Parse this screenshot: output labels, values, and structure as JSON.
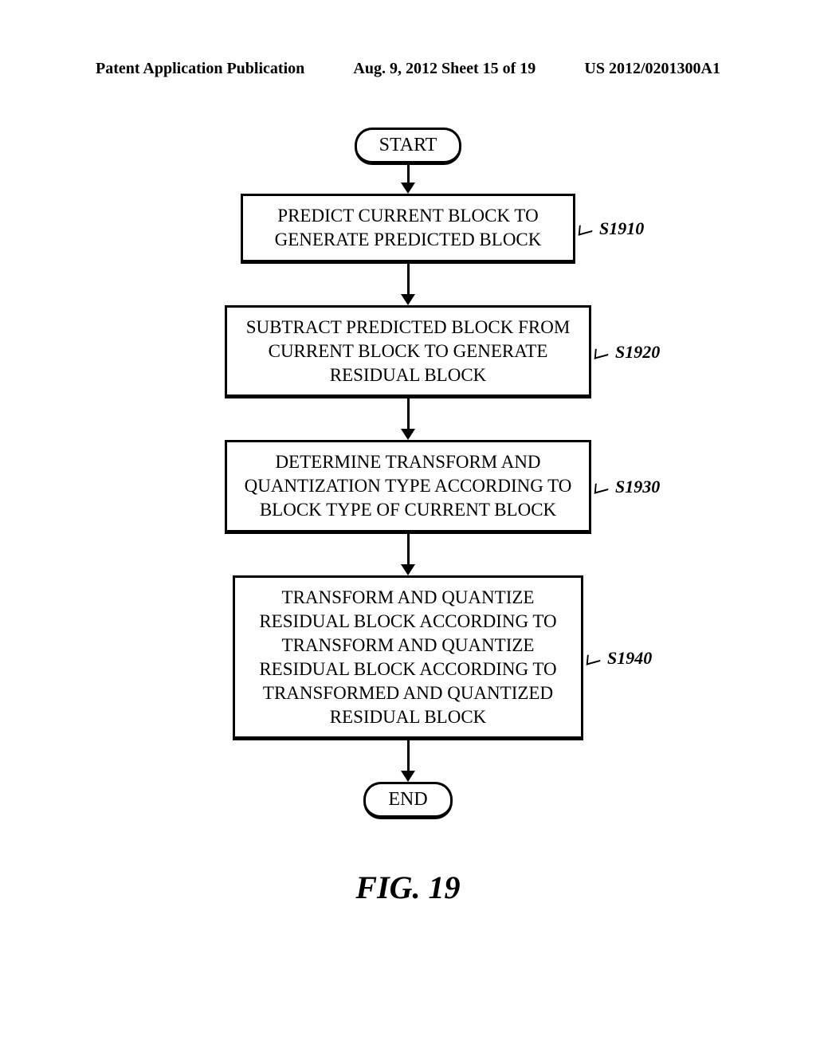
{
  "header": {
    "left": "Patent Application Publication",
    "center": "Aug. 9, 2012  Sheet 15 of 19",
    "right": "US 2012/0201300A1"
  },
  "flowchart": {
    "start": "START",
    "end": "END",
    "steps": [
      {
        "text": "PREDICT CURRENT BLOCK TO\nGENERATE PREDICTED BLOCK",
        "label": "S1910"
      },
      {
        "text": "SUBTRACT PREDICTED BLOCK FROM\nCURRENT BLOCK TO GENERATE\nRESIDUAL BLOCK",
        "label": "S1920"
      },
      {
        "text": "DETERMINE TRANSFORM AND\nQUANTIZATION TYPE ACCORDING TO\nBLOCK TYPE OF CURRENT BLOCK",
        "label": "S1930"
      },
      {
        "text": "TRANSFORM AND QUANTIZE\nRESIDUAL BLOCK ACCORDING TO\nTRANSFORM AND QUANTIZE\nRESIDUAL BLOCK ACCORDING TO\nTRANSFORMED AND QUANTIZED\nRESIDUAL BLOCK",
        "label": "S1940"
      }
    ]
  },
  "figure_label": "FIG. 19"
}
